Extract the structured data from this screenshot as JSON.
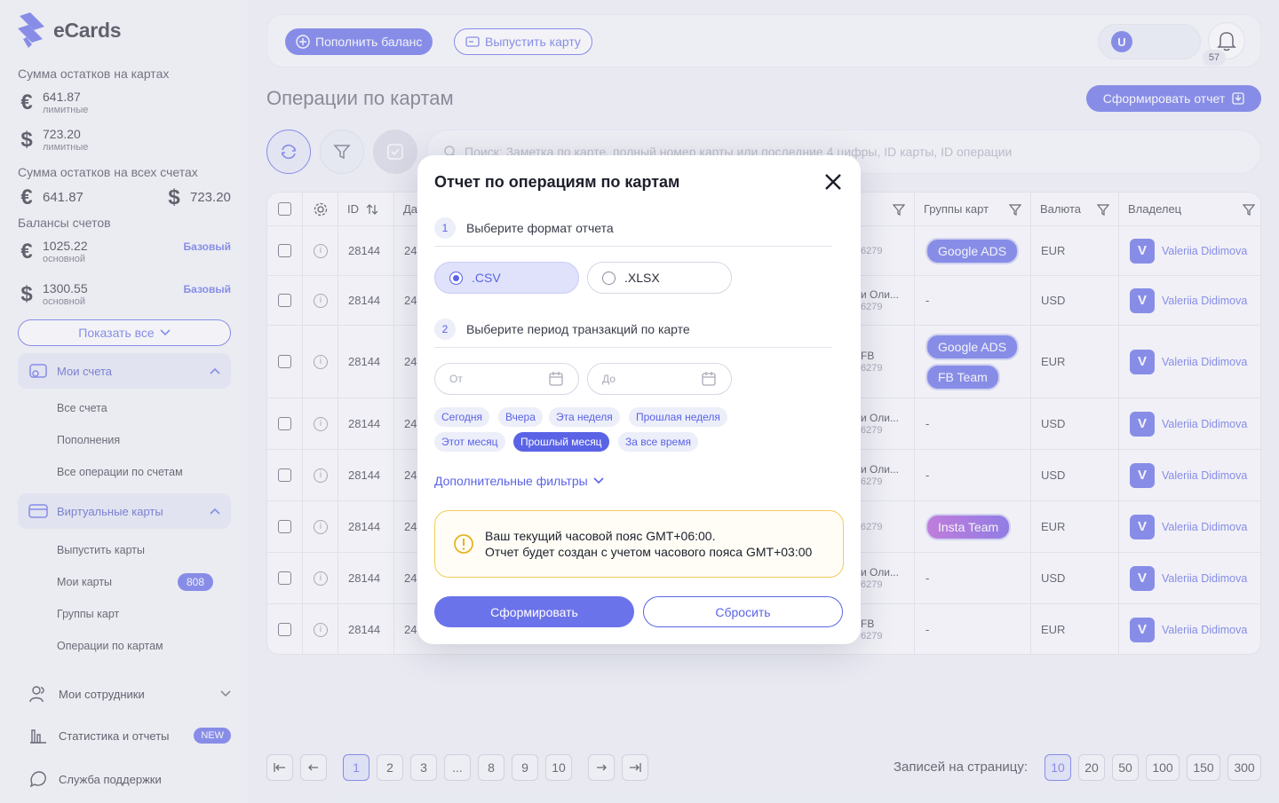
{
  "brand": {
    "name": "eCards",
    "accent": "#5a63e6"
  },
  "sidebar": {
    "cards_total_label": "Сумма остатков на картах",
    "cards_total": [
      {
        "currency": "€",
        "amount": "641.87",
        "sub": "лимитные"
      },
      {
        "currency": "$",
        "amount": "723.20",
        "sub": "лимитные"
      }
    ],
    "accounts_total_label": "Сумма остатков на всех счетах",
    "accounts_total": [
      {
        "currency": "€",
        "amount": "641.87"
      },
      {
        "currency": "$",
        "amount": "723.20"
      }
    ],
    "balances_label": "Балансы счетов",
    "balances": [
      {
        "currency": "€",
        "amount": "1025.22",
        "sub": "основной",
        "badge": "Базовый"
      },
      {
        "currency": "$",
        "amount": "1300.55",
        "sub": "основной",
        "badge": "Базовый"
      }
    ],
    "show_all": "Показать все",
    "groups": [
      {
        "label": "Мои счета",
        "items": [
          "Все счета",
          "Пополнения",
          "Все операции по счетам"
        ]
      },
      {
        "label": "Виртуальные карты",
        "items": [
          "Выпустить карты",
          "Мои карты",
          "Группы карт",
          "Операции по картам"
        ],
        "count": "808"
      }
    ],
    "main_items": [
      {
        "label": "Мои сотрудники"
      },
      {
        "label": "Статистика и отчеты",
        "badge": "NEW"
      },
      {
        "label": "Служба поддержки"
      }
    ]
  },
  "topbar": {
    "topup": "Пополнить баланс",
    "issue": "Выпустить карту",
    "user_initial": "U",
    "notifications": "57"
  },
  "page": {
    "title": "Операции по картам",
    "report_button": "Сформировать отчет",
    "search_placeholder": "Поиск: Заметка по карте, полный номер карты или последние 4 цифры, ID карты, ID операции"
  },
  "table": {
    "headers": {
      "id": "ID",
      "date": "Да",
      "groups": "Группы карт",
      "currency": "Валюта",
      "owner": "Владелец"
    },
    "rows": [
      {
        "id": "28144",
        "date": "24",
        "frag1": "",
        "frag2": "6279",
        "groups": [
          "Google ADS"
        ],
        "currency": "EUR",
        "owner": "Valeriia Didimova",
        "owner_initial": "V"
      },
      {
        "id": "28144",
        "date": "24",
        "frag1": "и Оли...",
        "frag2": "6279",
        "groups": [],
        "dash": "-",
        "currency": "USD",
        "owner": "Valeriia Didimova",
        "owner_initial": "V"
      },
      {
        "id": "28144",
        "date": "24",
        "frag1": "FB",
        "frag2": "6279",
        "groups": [
          "Google ADS",
          "FB Team"
        ],
        "currency": "EUR",
        "owner": "Valeriia Didimova",
        "owner_initial": "V"
      },
      {
        "id": "28144",
        "date": "24",
        "frag1": "и Оли...",
        "frag2": "6279",
        "groups": [],
        "dash": "-",
        "currency": "USD",
        "owner": "Valeriia Didimova",
        "owner_initial": "V"
      },
      {
        "id": "28144",
        "date": "24",
        "frag1": "и Оли...",
        "frag2": "6279",
        "groups": [],
        "dash": "-",
        "currency": "USD",
        "owner": "Valeriia Didimova",
        "owner_initial": "V"
      },
      {
        "id": "28144",
        "date": "24",
        "frag1": "",
        "frag2": "6279",
        "groups": [
          "Insta Team"
        ],
        "currency": "EUR",
        "owner": "Valeriia Didimova",
        "owner_initial": "V"
      },
      {
        "id": "28144",
        "date": "24",
        "frag1": "и Оли...",
        "frag2": "6279",
        "groups": [],
        "dash": "-",
        "currency": "USD",
        "owner": "Valeriia Didimova",
        "owner_initial": "V"
      },
      {
        "id": "28144",
        "date": "24",
        "frag1": "FB",
        "frag2": "6279",
        "groups": [],
        "dash": "-",
        "currency": "EUR",
        "owner": "Valeriia Didimova",
        "owner_initial": "V"
      }
    ]
  },
  "pagination": {
    "pages": [
      "1",
      "2",
      "3",
      "...",
      "8",
      "9",
      "10"
    ],
    "current": "1",
    "per_page_label": "Записей на страницу:",
    "per_page_options": [
      "10",
      "20",
      "50",
      "100",
      "150",
      "300"
    ],
    "per_page_selected": "10"
  },
  "modal": {
    "title": "Отчет по операциям по картам",
    "step1_num": "1",
    "step1_label": "Выберите формат отчета",
    "formats": [
      ".CSV",
      ".XLSX"
    ],
    "format_selected": ".CSV",
    "step2_num": "2",
    "step2_label": "Выберите период транзакций по карте",
    "from_placeholder": "От",
    "to_placeholder": "До",
    "periods": [
      "Сегодня",
      "Вчера",
      "Эта неделя",
      "Прошлая неделя",
      "Этот месяц",
      "Прошлый месяц",
      "За все время"
    ],
    "period_selected": "Прошлый месяц",
    "more_filters": "Дополнительные фильтры",
    "warning_line1": "Ваш текущий часовой пояс GMT+06:00.",
    "warning_line2": "Отчет будет создан с учетом часового пояса GMT+03:00",
    "submit": "Сформировать",
    "reset": "Сбросить"
  }
}
